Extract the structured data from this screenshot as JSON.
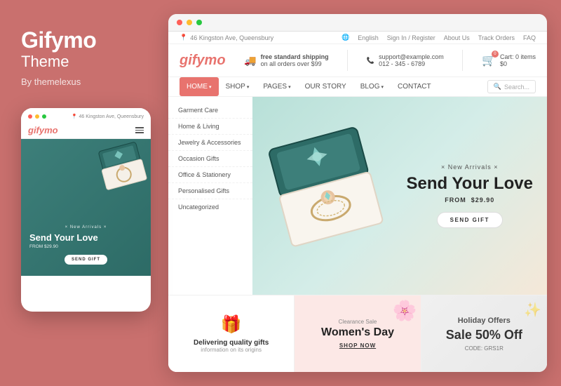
{
  "brand": {
    "title": "Gifymo",
    "subtitle": "Theme",
    "by": "By themelexus"
  },
  "mobile": {
    "address": "46 Kingston Ave, Queensbury",
    "logo": "gifymo",
    "hero": {
      "badge": "× New Arrivals ×",
      "title": "Send Your Love",
      "price": "FROM   $29.90",
      "button": "SEND GIFT"
    }
  },
  "browser": {
    "topbar": {
      "address": "46 Kingston Ave, Queensbury",
      "language": "English",
      "sign_in": "Sign In / Register",
      "about_us": "About Us",
      "track_orders": "Track Orders",
      "faq": "FAQ"
    },
    "header": {
      "logo": "gifymo",
      "shipping_title": "free standard shipping",
      "shipping_sub": "on all orders over $99",
      "support_email": "support@example.com",
      "support_phone": "012 - 345 - 6789",
      "cart_label": "Cart: 0 items",
      "cart_amount": "$0"
    },
    "nav": {
      "items": [
        "HOME",
        "SHOP",
        "PAGES",
        "OUR STORY",
        "BLOG",
        "CONTACT"
      ],
      "active": "HOME",
      "search_placeholder": "Search..."
    },
    "shop_menu": {
      "items": [
        "Garment Care",
        "Home & Living",
        "Jewelry & Accessories",
        "Occasion Gifts",
        "Office & Stationery",
        "Personalised Gifts",
        "Uncategorized"
      ]
    },
    "hero": {
      "badge": "× New Arrivals ×",
      "title": "Send Your Love",
      "from_label": "FROM",
      "price": "$29.90",
      "button": "SEND GIFT"
    },
    "cards": [
      {
        "type": "deliver",
        "icon": "🎁",
        "title": "Delivering quality gifts",
        "subtitle": "information on its origins"
      },
      {
        "type": "womens",
        "badge": "Clearance Sale",
        "title": "Women's Day",
        "button": "SHOP NOW"
      },
      {
        "type": "holiday",
        "title": "Holiday Offers",
        "sale": "Sale 50% Off",
        "code": "CODE: GRS1R"
      }
    ]
  }
}
